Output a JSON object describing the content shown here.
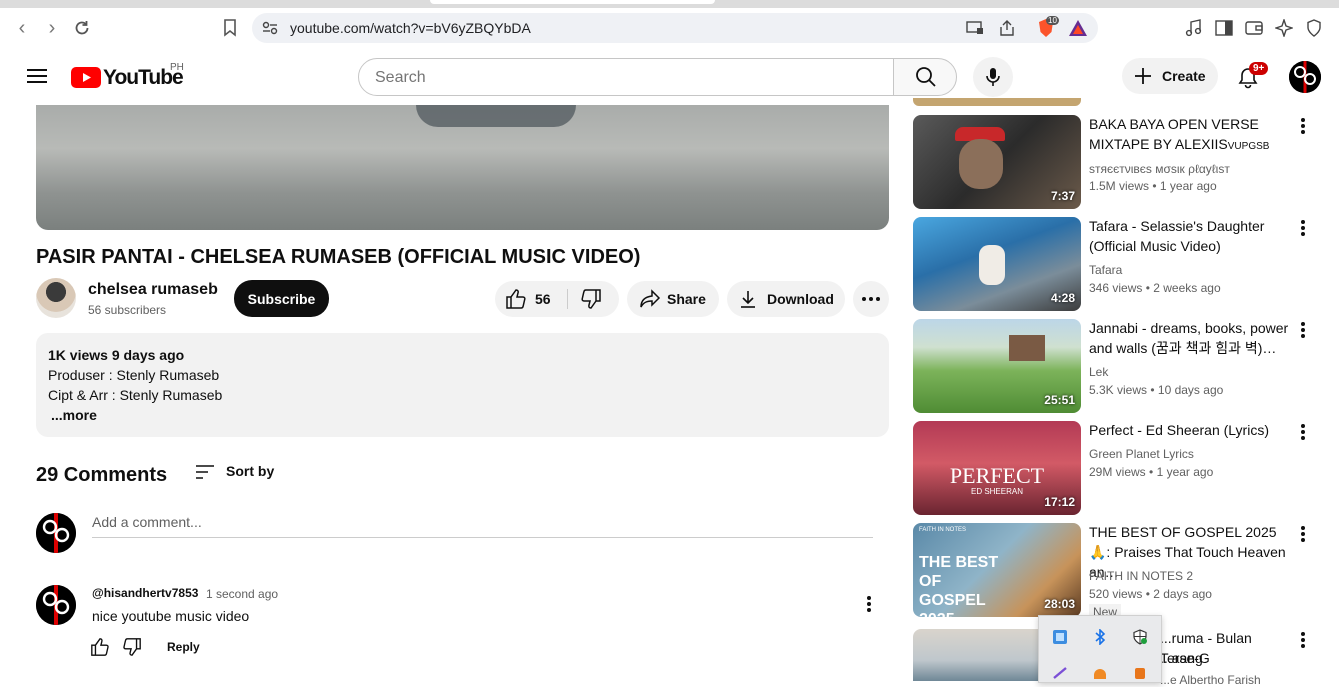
{
  "browser": {
    "url": "youtube.com/watch?v=bV6yZBQYbDA",
    "brave_badge": "10"
  },
  "header": {
    "logo_text": "YouTube",
    "country": "PH",
    "search_placeholder": "Search",
    "create_label": "Create",
    "notif_badge": "9+"
  },
  "video": {
    "title": "PASIR PANTAI - CHELSEA RUMASEB (OFFICIAL MUSIC VIDEO)",
    "channel": "chelsea rumaseb",
    "subscribers": "56 subscribers",
    "subscribe_label": "Subscribe",
    "likes": "56",
    "share_label": "Share",
    "download_label": "Download"
  },
  "description": {
    "views_date": "1K views  9 days ago",
    "line1": "Produser :  Stenly Rumaseb",
    "line2": "Cipt & Arr : Stenly Rumaseb",
    "more": "...more"
  },
  "comments": {
    "count_label": "29 Comments",
    "sort_label": "Sort by",
    "add_placeholder": "Add a comment...",
    "items": [
      {
        "author": "@hisandhertv7853",
        "time": "1 second ago",
        "text": "nice youtube music video",
        "reply_label": "Reply"
      }
    ]
  },
  "recommendations": [
    {
      "title": "BAKA BAYA OPEN VERSE MIXTAPE BY ALEXIIS",
      "title_suffix": "VUPGSB",
      "channel": "ѕтяєєтνιвєѕ мσѕιк ρℓαуℓιѕт",
      "views": "1.5M views",
      "age": "1 year ago",
      "duration": "7:37"
    },
    {
      "title": "Tafara - Selassie's Daughter (Official Music Video)",
      "channel": "Tafara",
      "views": "346 views",
      "age": "2 weeks ago",
      "duration": "4:28"
    },
    {
      "title": "Jannabi - dreams, books, power and walls (꿈과 책과 힘과 벽)…",
      "channel": "Lek",
      "views": "5.3K views",
      "age": "10 days ago",
      "duration": "25:51"
    },
    {
      "title": "Perfect - Ed Sheeran (Lyrics)",
      "channel": "Green Planet Lyrics",
      "views": "29M views",
      "age": "1 year ago",
      "duration": "17:12",
      "thumb_text": "PERFECT",
      "thumb_sub": "ED SHEERAN"
    },
    {
      "title": "THE BEST OF GOSPEL 2025 🙏: Praises That Touch Heaven an…",
      "channel": "FAITH IN NOTES 2",
      "views": "520 views",
      "age": "2 days ago",
      "duration": "28:03",
      "badge": "New",
      "thumb_text": "THE BEST OF GOSPEL 2025",
      "thumb_sub": "FAITH IN NOTES"
    },
    {
      "title": "...ruma - Bulan Terang",
      "title2": "...ase-G",
      "channel": "...e Albertho Farish"
    }
  ]
}
